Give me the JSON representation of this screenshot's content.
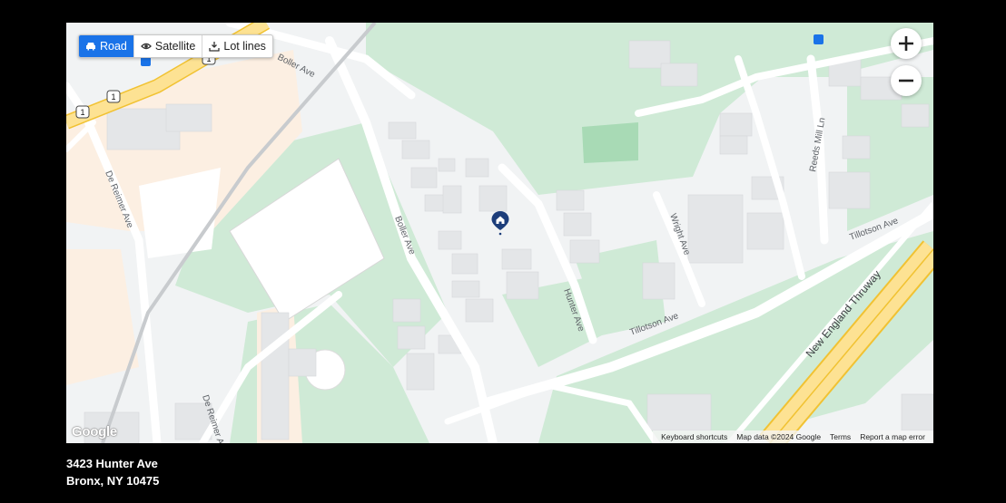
{
  "map": {
    "map_types": [
      {
        "label": "Road",
        "icon": "car-icon",
        "active": true
      },
      {
        "label": "Satellite",
        "icon": "eye-icon",
        "active": false
      },
      {
        "label": "Lot lines",
        "icon": "lot-lines-icon",
        "active": false
      }
    ],
    "zoom_in": "+",
    "zoom_out": "−",
    "streets": {
      "boller_top": "Boller Ave",
      "boller_mid": "Boller Ave",
      "de_reimer_top": "De Reimer Ave",
      "de_reimer_bottom": "De Reimer Ave",
      "hunter": "Hunter Ave",
      "tillotson_mid": "Tillotson Ave",
      "tillotson_right": "Tillotson Ave",
      "wright": "Wright Ave",
      "reeds_mill": "Reeds Mill Ln",
      "thruway": "New England Thruway",
      "route_shield_1": "1",
      "route_shield_2": "1",
      "route_shield_3": "1"
    },
    "logo": "Google",
    "attribution": {
      "keyboard": "Keyboard shortcuts",
      "data": "Map data ©2024 Google",
      "terms": "Terms",
      "report": "Report a map error"
    },
    "colors": {
      "park": "#cfead6",
      "field": "#a8dab5",
      "building": "#e4e6e8",
      "highway": "#fde293",
      "highway_edge": "#f1c232",
      "pin": "#1c3d7a",
      "active_tab": "#1a73e8"
    }
  },
  "address": {
    "line1": "3423 Hunter Ave",
    "line2": "Bronx, NY 10475"
  }
}
